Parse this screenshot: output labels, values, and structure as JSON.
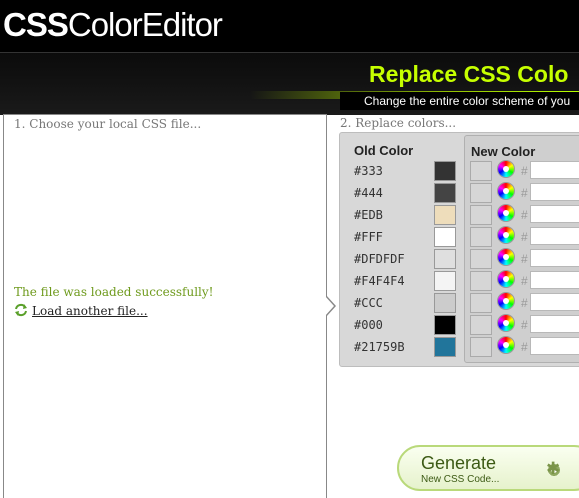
{
  "app": {
    "logo_bold": "CSS",
    "logo_rest": "ColorEditor"
  },
  "banner": {
    "title": "Replace CSS Colo",
    "subtitle": "Change the entire color scheme of you"
  },
  "left": {
    "step_label": "1. Choose your local CSS file...",
    "status": "The file was loaded successfully!",
    "reload_link": "Load another file..."
  },
  "right": {
    "step_label": "2. Replace colors...",
    "old_header": "Old Color",
    "new_header": "New Color",
    "hash": "#",
    "rows": [
      {
        "code": "#333",
        "color": "#333333"
      },
      {
        "code": "#444",
        "color": "#444444"
      },
      {
        "code": "#EDB",
        "color": "#EEDDBB"
      },
      {
        "code": "#FFF",
        "color": "#FFFFFF"
      },
      {
        "code": "#DFDFDF",
        "color": "#DFDFDF"
      },
      {
        "code": "#F4F4F4",
        "color": "#F4F4F4"
      },
      {
        "code": "#CCC",
        "color": "#CCCCCC"
      },
      {
        "code": "#000",
        "color": "#000000"
      },
      {
        "code": "#21759B",
        "color": "#21759B"
      }
    ]
  },
  "generate": {
    "title": "Generate",
    "subtitle": "New CSS Code..."
  }
}
